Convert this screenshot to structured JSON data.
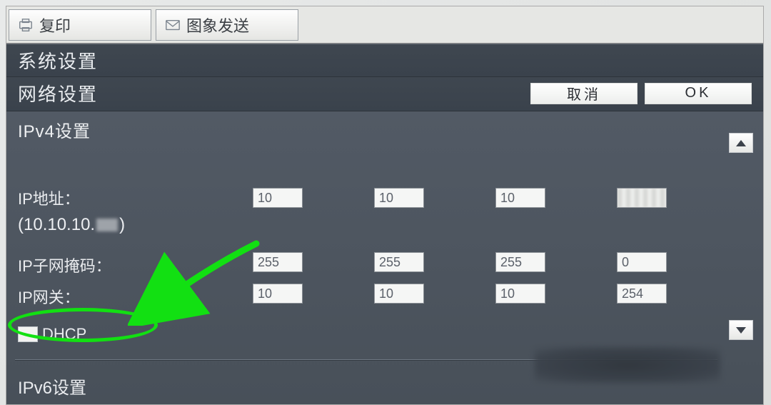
{
  "tabs": {
    "copy": "复印",
    "image_send": "图象发送"
  },
  "bars": {
    "system_settings": "系统设置",
    "network_settings": "网络设置"
  },
  "buttons": {
    "cancel": "取消",
    "ok": "OK"
  },
  "ipv4": {
    "section": "IPv4设置",
    "ip_label": "IP地址：",
    "current_prefix": "(10.10.10.",
    "current_suffix": ")",
    "subnet_label": "IP子网掩码：",
    "gateway_label": "IP网关：",
    "ip": [
      "10",
      "10",
      "10",
      ""
    ],
    "subnet": [
      "255",
      "255",
      "255",
      "0"
    ],
    "gateway": [
      "10",
      "10",
      "10",
      "254"
    ],
    "dhcp": "DHCP"
  },
  "ipv6": {
    "section": "IPv6设置"
  }
}
